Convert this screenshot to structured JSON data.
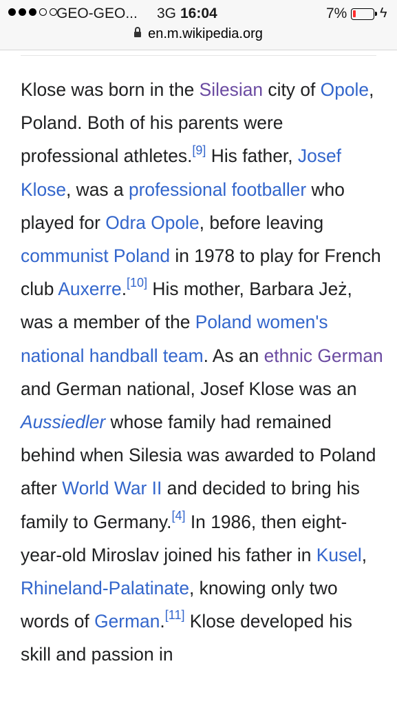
{
  "status_bar": {
    "carrier": "GEO-GEO...",
    "network": "3G",
    "time": "16:04",
    "battery_percent": "7%",
    "signal_bars_filled": 3,
    "signal_bars_total": 5
  },
  "address_bar": {
    "url": "en.m.wikipedia.org"
  },
  "article": {
    "t1": "Klose was born in the ",
    "l_silesian": "Silesian",
    "t2": " city of ",
    "l_opole": "Opole",
    "t3": ", Poland. Both of his parents were professional athletes.",
    "ref9": "[9]",
    "t4": " His father, ",
    "l_josef": "Josef Klose",
    "t5": ", was a ",
    "l_profoot": "professional footballer",
    "t6": " who played for ",
    "l_odra": "Odra Opole",
    "t7": ", before leaving ",
    "l_communist": "communist Poland",
    "t8": " in 1978 to play for French club ",
    "l_auxerre": "Auxerre",
    "t9": ".",
    "ref10": "[10]",
    "t10": " His mother, Barbara Jeż, was a member of the ",
    "l_handball": "Poland women's national handball team",
    "t11": ". As an ",
    "l_ethnic": "ethnic German",
    "t12": " and German national, Josef Klose was an ",
    "l_aussiedler": "Aussiedler",
    "t13": " whose family had remained behind when Silesia was awarded to Poland after ",
    "l_ww2": "World War II",
    "t14": " and decided to bring his family to Germany.",
    "ref4": "[4]",
    "t15": " In 1986, then eight-year-old Miroslav joined his father in ",
    "l_kusel": "Kusel",
    "t16": ", ",
    "l_rhineland": "Rhineland-Palatinate",
    "t17": ", knowing only two words of ",
    "l_german": "German",
    "t18": ".",
    "ref11": "[11]",
    "t19": " Klose developed his skill and passion in"
  },
  "colors": {
    "link": "#3366cc",
    "visited_link": "#6b4ba1",
    "battery_low": "#ff2d2d"
  }
}
